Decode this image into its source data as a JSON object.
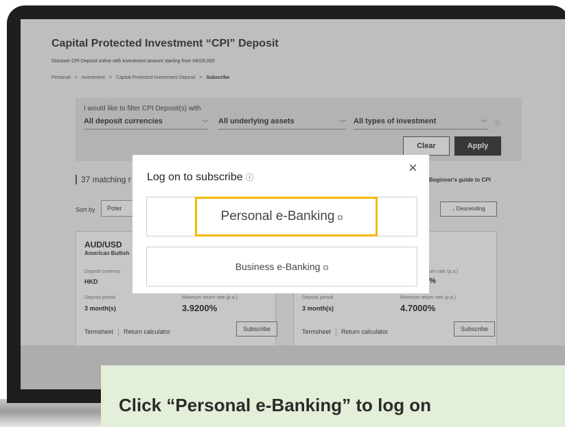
{
  "page": {
    "title": "Capital Protected Investment “CPI” Deposit",
    "subtitle": "Discover CPI Deposit online with investment amount starting from HKD5,000",
    "breadcrumbs": [
      "Personal",
      "Investment",
      "Capital Protected Investment Deposit",
      "Subscribe"
    ],
    "breadcrumb_separator": ">"
  },
  "filter": {
    "label": "I would like to filter CPI Deposit(s) with",
    "currency": "All deposit currencies",
    "assets": "All underlying assets",
    "investment_type": "All types of investment",
    "clear_label": "Clear",
    "apply_label": "Apply"
  },
  "results": {
    "count_text": "37 matching r",
    "guide_text": ") Beginner's guide to CPI"
  },
  "sort": {
    "label": "Sort by",
    "value": "Poter",
    "order_label": "Descending"
  },
  "cards": [
    {
      "pair": "AUD/USD",
      "type": "American Bullish",
      "currency_label": "Deposit currency",
      "currency": "HKD",
      "period_label": "Deposit period",
      "period": "3 month(s)",
      "rate_label": "Minimum return rate (p.a.)",
      "rate": "3.9200%",
      "termsheet": "Termsheet",
      "calculator": "Return calculator",
      "subscribe": "Subscribe"
    },
    {
      "max_rate_label": "urn rate (p.a.)",
      "max_rate": "%",
      "period_label": "Deposit period",
      "period": "3 month(s)",
      "rate_label": "Minimum return rate (p.a.)",
      "rate": "4.7000%",
      "termsheet": "Termsheet",
      "calculator": "Return calculator",
      "subscribe": "Subscribe"
    }
  ],
  "modal": {
    "title": "Log on to subscribe",
    "personal_label": "Personal e-Banking",
    "business_label": "Business e-Banking",
    "close_glyph": "×",
    "info_glyph": "ⓘ",
    "external_glyph": "⧉"
  },
  "caption": {
    "text": "Click “Personal e-Banking” to log on"
  },
  "colors": {
    "highlight": "#f3b800",
    "caption_bg": "#e3efd9",
    "apply_bg": "#333333"
  }
}
